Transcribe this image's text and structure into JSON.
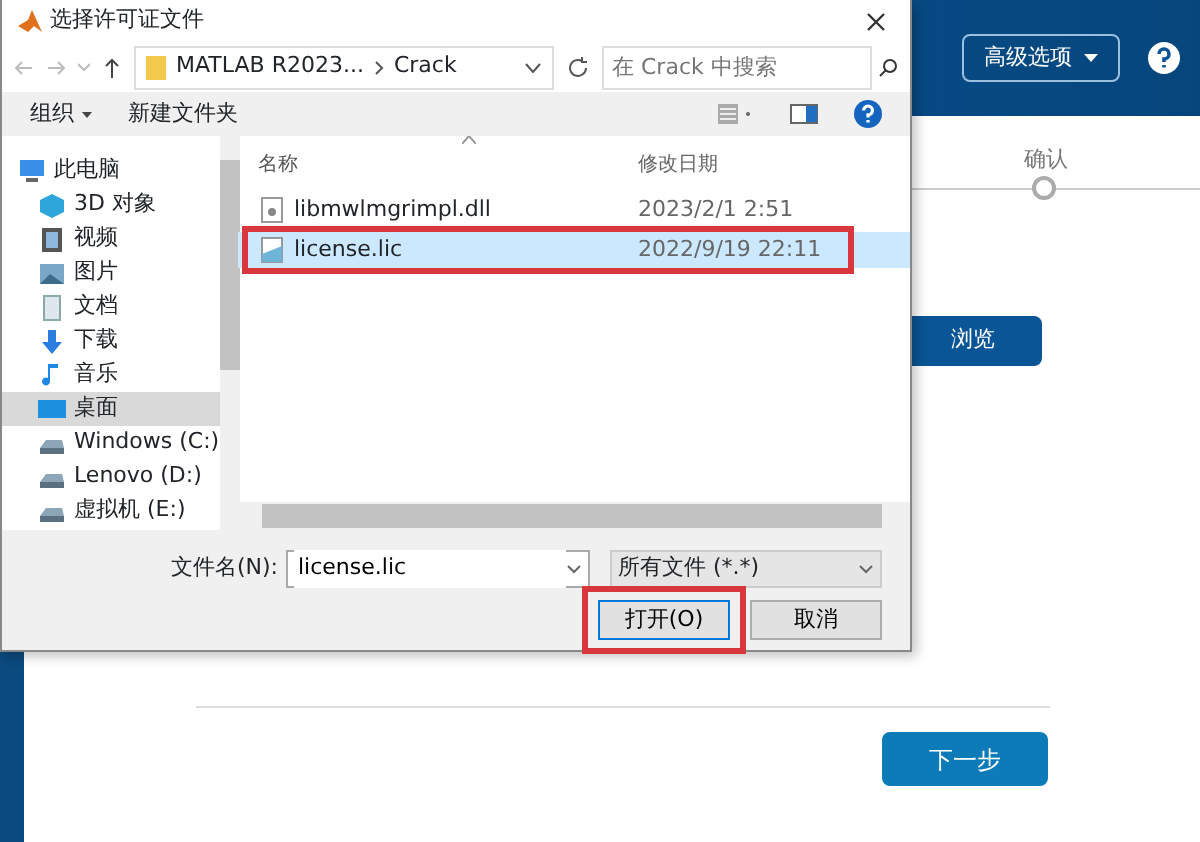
{
  "installer": {
    "header_button": "高级选项",
    "step_label": "确认",
    "browse_button": "浏览",
    "next_button": "下一步"
  },
  "dialog": {
    "title": "选择许可证文件",
    "breadcrumb": [
      "MATLAB R2023...",
      "Crack"
    ],
    "search": {
      "placeholder": "在 Crack 中搜索"
    },
    "toolbar": {
      "organize": "组织",
      "new_folder": "新建文件夹"
    },
    "sidebar": [
      {
        "label": "此电脑",
        "kind": "computer",
        "selected": false,
        "children": [
          {
            "label": "3D 对象",
            "kind": "cube",
            "selected": false
          },
          {
            "label": "视频",
            "kind": "video",
            "selected": false
          },
          {
            "label": "图片",
            "kind": "picture",
            "selected": false
          },
          {
            "label": "文档",
            "kind": "document",
            "selected": false
          },
          {
            "label": "下载",
            "kind": "download",
            "selected": false
          },
          {
            "label": "音乐",
            "kind": "music",
            "selected": false
          },
          {
            "label": "桌面",
            "kind": "desktop",
            "selected": true
          },
          {
            "label": "Windows (C:)",
            "kind": "drive",
            "selected": false
          },
          {
            "label": "Lenovo (D:)",
            "kind": "drive",
            "selected": false
          },
          {
            "label": "虚拟机 (E:)",
            "kind": "drive",
            "selected": false
          }
        ]
      }
    ],
    "columns": [
      "名称",
      "修改日期"
    ],
    "files": [
      {
        "name": "libmwlmgrimpl.dll",
        "modified": "2023/2/1 2:51",
        "kind": "dll",
        "selected": false,
        "highlighted": false
      },
      {
        "name": "license.lic",
        "modified": "2022/9/19 22:11",
        "kind": "lic",
        "selected": true,
        "highlighted": true
      }
    ],
    "filename": {
      "label": "文件名(N):",
      "value": "license.lic"
    },
    "filetype": "所有文件 (*.*)",
    "buttons": [
      {
        "label": "打开(O)",
        "default": true,
        "highlighted": true
      },
      {
        "label": "取消",
        "default": false,
        "highlighted": false
      }
    ]
  }
}
